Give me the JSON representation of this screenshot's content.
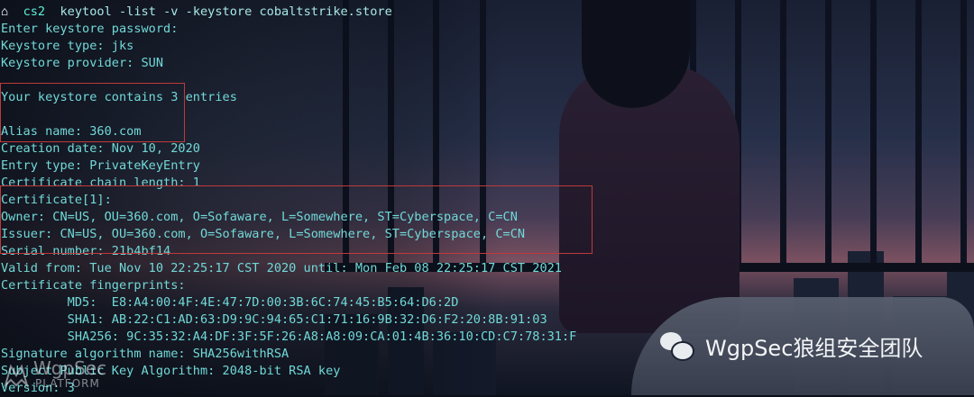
{
  "terminal": {
    "prompt": {
      "icon": "⌂",
      "dir": "cs2",
      "command": "keytool -list -v -keystore cobaltstrike.store"
    },
    "lines": [
      "Enter keystore password:",
      "Keystore type: jks",
      "Keystore provider: SUN",
      "",
      "Your keystore contains 3 entries",
      "",
      "Alias name: 360.com",
      "Creation date: Nov 10, 2020",
      "Entry type: PrivateKeyEntry",
      "Certificate chain length: 1",
      "Certificate[1]:",
      "Owner: CN=US, OU=360.com, O=Sofaware, L=Somewhere, ST=Cyberspace, C=CN",
      "Issuer: CN=US, OU=360.com, O=Sofaware, L=Somewhere, ST=Cyberspace, C=CN",
      "Serial number: 21b4bf14",
      "Valid from: Tue Nov 10 22:25:17 CST 2020 until: Mon Feb 08 22:25:17 CST 2021",
      "Certificate fingerprints:",
      "         MD5:  E8:A4:00:4F:4E:47:7D:00:3B:6C:74:45:B5:64:D6:2D",
      "         SHA1: AB:22:C1:AD:63:D9:9C:94:65:C1:71:16:9B:32:D6:F2:20:8B:91:03",
      "         SHA256: 9C:35:32:A4:DF:3F:5F:26:A8:A8:09:CA:01:4B:36:10:CD:C7:78:31:F",
      "Signature algorithm name: SHA256withRSA",
      "Subject Public Key Algorithm: 2048-bit RSA key",
      "Version: 3"
    ]
  },
  "watermark": {
    "icon": "wechat-icon",
    "text": "WgpSec狼组安全团队"
  },
  "logo": {
    "name": "WgpSec",
    "subtitle": "PLATFORM"
  },
  "colors": {
    "terminal_text": "#71d9d8",
    "highlight_box": "#c0393b"
  }
}
